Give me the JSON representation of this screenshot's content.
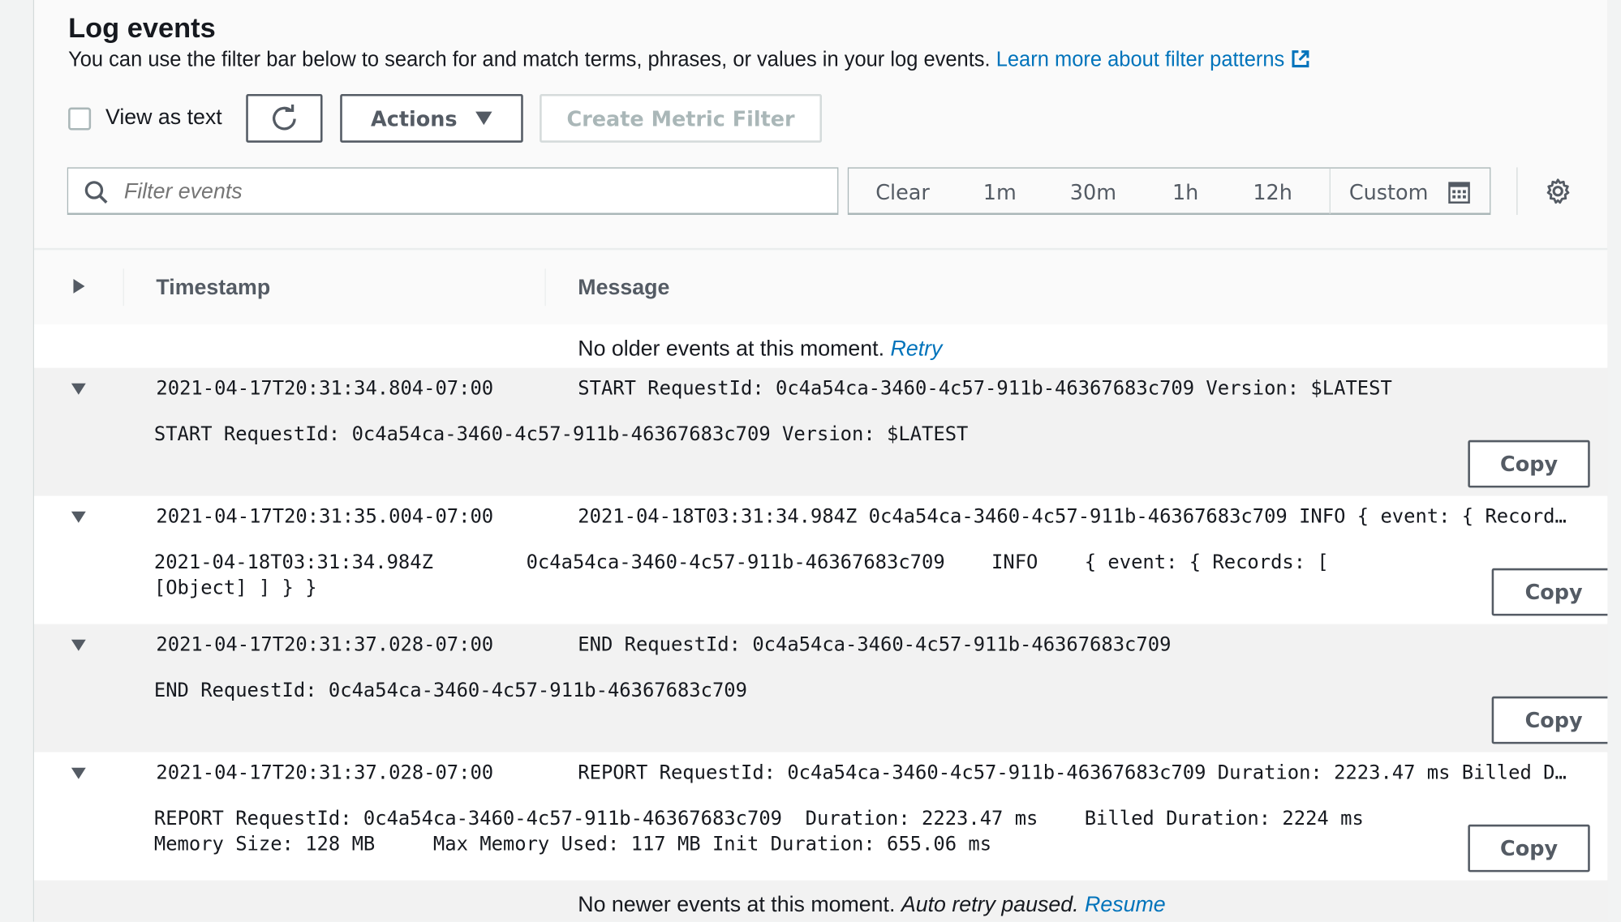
{
  "header": {
    "title": "Log events",
    "description": "You can use the filter bar below to search for and match terms, phrases, or values in your log events.",
    "learn_more": "Learn more about filter patterns"
  },
  "toolbar": {
    "view_as_text": "View as text",
    "view_as_text_checked": false,
    "actions": "Actions",
    "create_metric_filter": "Create Metric Filter"
  },
  "filter": {
    "placeholder": "Filter events",
    "ranges": [
      "Clear",
      "1m",
      "30m",
      "1h",
      "12h"
    ],
    "custom": "Custom"
  },
  "table": {
    "col_timestamp": "Timestamp",
    "col_message": "Message",
    "older": {
      "text": "No older events at this moment.",
      "link": "Retry"
    },
    "newer": {
      "text": "No newer events at this moment.",
      "italic": "Auto retry paused.",
      "link": "Resume"
    },
    "copy_label": "Copy",
    "rows": [
      {
        "timestamp": "2021-04-17T20:31:34.804-07:00",
        "message": "START RequestId: 0c4a54ca-3460-4c57-911b-46367683c709 Version: $LATEST",
        "detail": [
          "START RequestId: 0c4a54ca-3460-4c57-911b-46367683c709 Version: $LATEST"
        ]
      },
      {
        "timestamp": "2021-04-17T20:31:35.004-07:00",
        "message": "2021-04-18T03:31:34.984Z 0c4a54ca-3460-4c57-911b-46367683c709 INFO { event: { Record…",
        "detail": [
          "2021-04-18T03:31:34.984Z        0c4a54ca-3460-4c57-911b-46367683c709    INFO    { event: { Records: [",
          "[Object] ] } }"
        ]
      },
      {
        "timestamp": "2021-04-17T20:31:37.028-07:00",
        "message": "END RequestId: 0c4a54ca-3460-4c57-911b-46367683c709",
        "detail": [
          "END RequestId: 0c4a54ca-3460-4c57-911b-46367683c709"
        ]
      },
      {
        "timestamp": "2021-04-17T20:31:37.028-07:00",
        "message": "REPORT RequestId: 0c4a54ca-3460-4c57-911b-46367683c709 Duration: 2223.47 ms Billed D…",
        "detail": [
          "REPORT RequestId: 0c4a54ca-3460-4c57-911b-46367683c709  Duration: 2223.47 ms    Billed Duration: 2224 ms",
          "Memory Size: 128 MB     Max Memory Used: 117 MB Init Duration: 655.06 ms"
        ]
      }
    ]
  },
  "colors": {
    "link": "#0073bb",
    "row_alt": "#f2f2f2",
    "border": "#545b64"
  }
}
